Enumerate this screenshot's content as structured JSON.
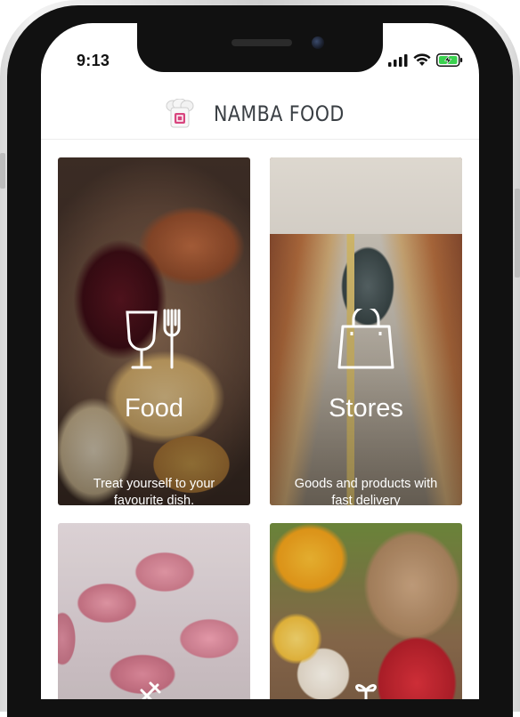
{
  "status_bar": {
    "time": "9:13"
  },
  "header": {
    "brand": "NAMBA FOOD",
    "logo_icon": "chef-hat-logo-icon"
  },
  "cards": [
    {
      "title": "Food",
      "description": "Treat yourself to your favourite dish.",
      "icon": "glass-and-fork-icon"
    },
    {
      "title": "Stores",
      "description": "Goods and products with fast delivery",
      "icon": "shopping-bag-icon"
    },
    {
      "title": "",
      "description": "",
      "icon": "pharmacy-icon"
    },
    {
      "title": "",
      "description": "",
      "icon": "gift-icon"
    }
  ],
  "colors": {
    "battery": "#3ad24f",
    "brand_logo": "#d8457e",
    "text_dark": "#111111"
  }
}
